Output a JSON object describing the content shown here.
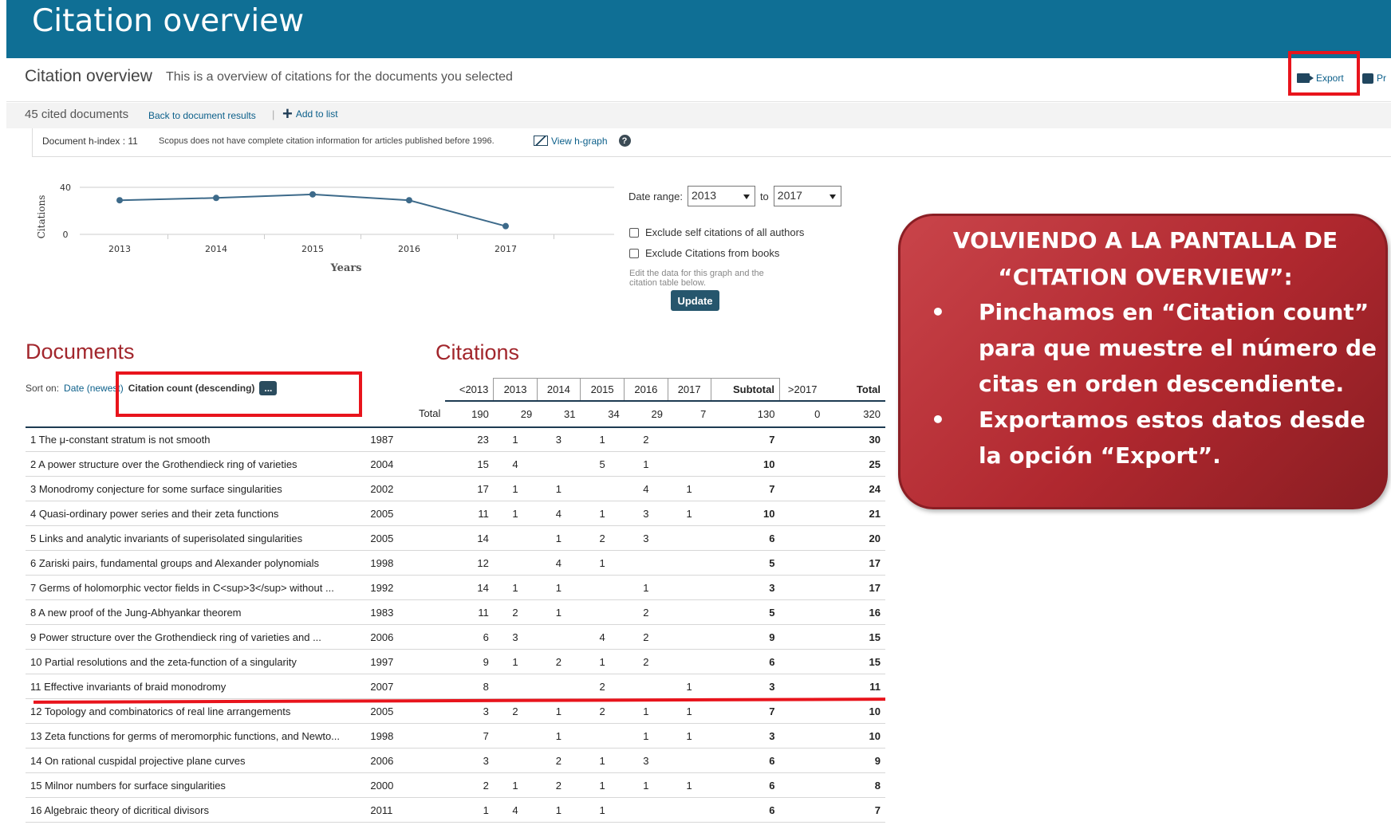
{
  "header": {
    "title": "Citation overview"
  },
  "overview": {
    "title": "Citation overview",
    "subtitle": "This is a overview of citations for the documents you selected",
    "export_label": "Export",
    "print_label": "Pr"
  },
  "toolbar": {
    "count": "45 cited documents",
    "back": "Back to document results",
    "separator": "|",
    "add": "Add to list"
  },
  "hindex": {
    "label": "Document h-index : 11",
    "note": "Scopus does not have complete citation information for articles published before 1996.",
    "graph_link": "View h-graph",
    "help": "?"
  },
  "controls": {
    "date_label": "Date range:",
    "from": "2013",
    "to_label": "to",
    "to": "2017",
    "exclude_self": "Exclude self citations of all authors",
    "exclude_books": "Exclude Citations from books",
    "edit_note": "Edit the data for this graph and the citation table below.",
    "update": "Update"
  },
  "chart_data": {
    "type": "line",
    "x": [
      "2013",
      "2014",
      "2015",
      "2016",
      "2017"
    ],
    "values": [
      29,
      31,
      34,
      29,
      7
    ],
    "xlabel": "Years",
    "ylabel": "Citations",
    "yticks": [
      "40",
      "0"
    ],
    "ylim": [
      0,
      40
    ]
  },
  "sections": {
    "documents": "Documents",
    "citations": "Citations"
  },
  "sort": {
    "label": "Sort on:",
    "date_option": "Date (newest)",
    "active": "Citation count (descending)",
    "more": "..."
  },
  "table": {
    "years": [
      "<2013",
      "2013",
      "2014",
      "2015",
      "2016",
      "2017",
      "Subtotal",
      ">2017",
      "Total"
    ],
    "totals_label": "Total",
    "totals": [
      "190",
      "29",
      "31",
      "34",
      "29",
      "7",
      "130",
      "0",
      "320"
    ],
    "rows": [
      {
        "title": "1  The μ-constant stratum is not smooth",
        "year": "1987",
        "c": [
          "23",
          "1",
          "3",
          "1",
          "2",
          "",
          "7",
          "",
          "30"
        ]
      },
      {
        "title": "2  A power structure over the Grothendieck ring of varieties",
        "year": "2004",
        "c": [
          "15",
          "4",
          "",
          "5",
          "1",
          "",
          "10",
          "",
          "25"
        ]
      },
      {
        "title": "3  Monodromy conjecture for some surface singularities",
        "year": "2002",
        "c": [
          "17",
          "1",
          "1",
          "",
          "4",
          "1",
          "7",
          "",
          "24"
        ]
      },
      {
        "title": "4  Quasi-ordinary power series and their zeta functions",
        "year": "2005",
        "c": [
          "11",
          "1",
          "4",
          "1",
          "3",
          "1",
          "10",
          "",
          "21"
        ]
      },
      {
        "title": "5  Links and analytic invariants of superisolated singularities",
        "year": "2005",
        "c": [
          "14",
          "",
          "1",
          "2",
          "3",
          "",
          "6",
          "",
          "20"
        ]
      },
      {
        "title": "6  Zariski pairs, fundamental groups and Alexander polynomials",
        "year": "1998",
        "c": [
          "12",
          "",
          "4",
          "1",
          "",
          "",
          "5",
          "",
          "17"
        ]
      },
      {
        "title": "7  Germs of holomorphic vector fields in C<sup>3</sup> without ...",
        "year": "1992",
        "c": [
          "14",
          "1",
          "1",
          "",
          "1",
          "",
          "3",
          "",
          "17"
        ]
      },
      {
        "title": "8  A new proof of the Jung-Abhyankar theorem",
        "year": "1983",
        "c": [
          "11",
          "2",
          "1",
          "",
          "2",
          "",
          "5",
          "",
          "16"
        ]
      },
      {
        "title": "9  Power structure over the Grothendieck ring of varieties and ...",
        "year": "2006",
        "c": [
          "6",
          "3",
          "",
          "4",
          "2",
          "",
          "9",
          "",
          "15"
        ]
      },
      {
        "title": "10 Partial resolutions and the zeta-function of a singularity",
        "year": "1997",
        "c": [
          "9",
          "1",
          "2",
          "1",
          "2",
          "",
          "6",
          "",
          "15"
        ]
      },
      {
        "title": "11 Effective invariants of braid monodromy",
        "year": "2007",
        "c": [
          "8",
          "",
          "",
          "2",
          "",
          "1",
          "3",
          "",
          "11"
        ]
      },
      {
        "title": "12 Topology and combinatorics of real line arrangements",
        "year": "2005",
        "c": [
          "3",
          "2",
          "1",
          "2",
          "1",
          "1",
          "7",
          "",
          "10"
        ]
      },
      {
        "title": "13 Zeta functions for germs of meromorphic functions, and Newto...",
        "year": "1998",
        "c": [
          "7",
          "",
          "1",
          "",
          "1",
          "1",
          "3",
          "",
          "10"
        ]
      },
      {
        "title": "14 On rational cuspidal projective plane curves",
        "year": "2006",
        "c": [
          "3",
          "",
          "2",
          "1",
          "3",
          "",
          "6",
          "",
          "9"
        ]
      },
      {
        "title": "15 Milnor numbers for surface singularities",
        "year": "2000",
        "c": [
          "2",
          "1",
          "2",
          "1",
          "1",
          "1",
          "6",
          "",
          "8"
        ]
      },
      {
        "title": "16 Algebraic theory of dicritical divisors",
        "year": "2011",
        "c": [
          "1",
          "4",
          "1",
          "1",
          "",
          "",
          "6",
          "",
          "7"
        ]
      }
    ]
  },
  "callout": {
    "title": "VOLVIENDO A LA PANTALLA DE “CITATION OVERVIEW”:",
    "bullets": [
      "Pinchamos en “Citation count” para que muestre el número de citas en orden descendiente.",
      "Exportamos estos datos desde la opción “Export”."
    ]
  },
  "colors": {
    "topbar": "#0f6f95",
    "accent_red": "#e8141c",
    "section_heading": "#a2262c",
    "callout": "#b0282f",
    "line": "#3d6a8a"
  }
}
